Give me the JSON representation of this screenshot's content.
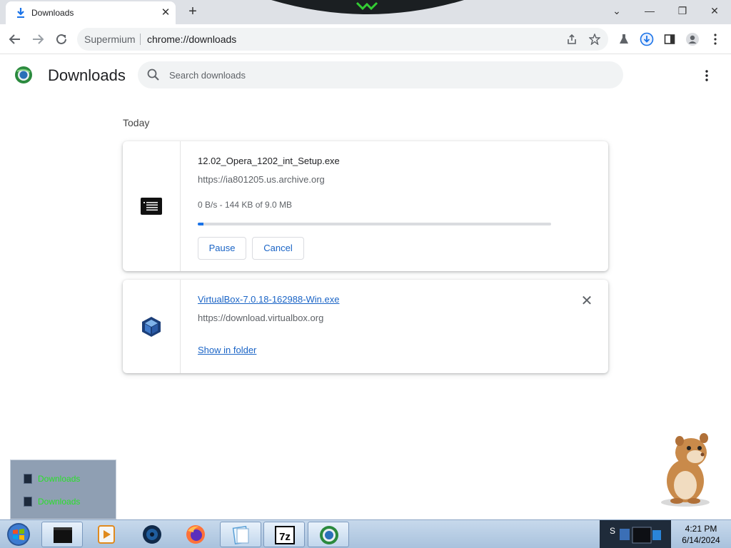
{
  "browser": {
    "tab": {
      "title": "Downloads",
      "close_glyph": "✕"
    },
    "new_tab_glyph": "+",
    "window_controls": {
      "minimize": "⌄",
      "restore": "—",
      "maximize": "❐",
      "close": "✕"
    },
    "omnibox": {
      "site_label": "Supermium",
      "url": "chrome://downloads"
    }
  },
  "page": {
    "title": "Downloads",
    "search": {
      "placeholder": "Search downloads",
      "value": ""
    },
    "date_group": "Today",
    "downloads": [
      {
        "file_name": "12.02_Opera_1202_int_Setup.exe",
        "source_url": "https://ia801205.us.archive.org",
        "status": "0 B/s - 144 KB of 9.0 MB",
        "progress_fraction": 0.016,
        "pause_label": "Pause",
        "cancel_label": "Cancel",
        "icon": "installer-file-icon"
      },
      {
        "file_name": "VirtualBox-7.0.18-162988-Win.exe",
        "source_url": "https://download.virtualbox.org",
        "show_in_folder_label": "Show in folder",
        "remove_glyph": "✕",
        "icon": "virtualbox-icon"
      }
    ]
  },
  "taskbar_popup": {
    "items": [
      {
        "label": "Downloads"
      },
      {
        "label": "Downloads"
      }
    ]
  },
  "taskbar": {
    "apps": [
      "terminal",
      "media-player",
      "system-orb",
      "firefox",
      "notepad",
      "7zip",
      "supermium"
    ],
    "clock": {
      "time": "4:21 PM",
      "date": "6/14/2024"
    },
    "tray_letter": "S"
  },
  "colors": {
    "accent": "#1a73e8",
    "link": "#1a64c6",
    "popup_text": "#2ae02a"
  }
}
